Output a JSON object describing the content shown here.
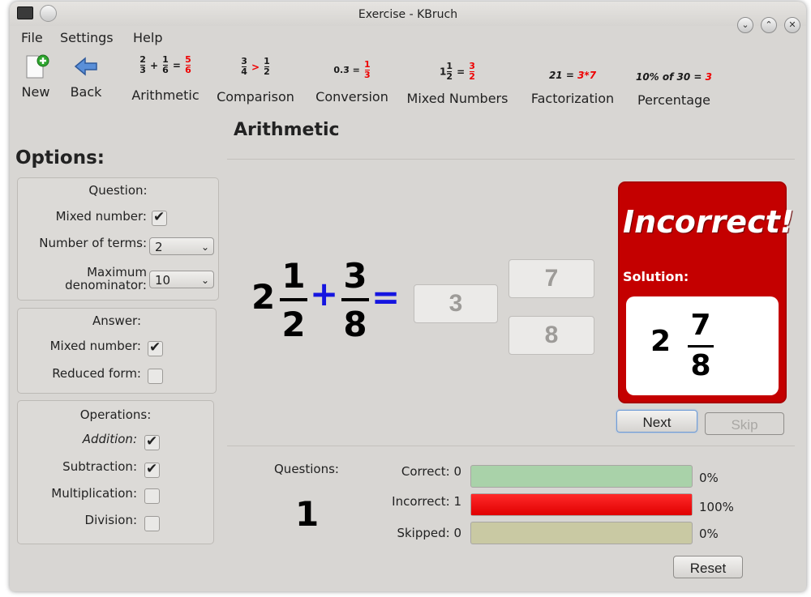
{
  "window": {
    "title": "Exercise - KBruch"
  },
  "menu": {
    "file": "File",
    "settings": "Settings",
    "help": "Help"
  },
  "toolbar": {
    "new": "New",
    "back": "Back",
    "arithmetic": "Arithmetic",
    "comparison": "Comparison",
    "conversion": "Conversion",
    "mixed_numbers": "Mixed Numbers",
    "factorization": "Factorization",
    "percentage": "Percentage",
    "icons": {
      "arithmetic": {
        "a_num": "2",
        "a_den": "3",
        "op": "+",
        "b_num": "1",
        "b_den": "6",
        "eq": "=",
        "r_num": "5",
        "r_den": "6"
      },
      "comparison": {
        "a_num": "3",
        "a_den": "4",
        "op": ">",
        "b_num": "1",
        "b_den": "2"
      },
      "conversion": {
        "left": "0.3̄ =",
        "r_num": "1",
        "r_den": "3"
      },
      "mixed": {
        "whole": "1",
        "a_num": "1",
        "a_den": "2",
        "eq": "=",
        "r_num": "3",
        "r_den": "2"
      },
      "factorization": {
        "left": "21 =",
        "right": "3*7"
      },
      "percentage": {
        "left": "10% of 30 =",
        "right": "3"
      }
    }
  },
  "heading": "Arithmetic",
  "options": {
    "title": "Options:",
    "question": {
      "title": "Question:",
      "mixed_number": "Mixed number:",
      "mixed_number_checked": true,
      "number_of_terms": "Number of terms:",
      "number_of_terms_value": "2",
      "maximum": "Maximum",
      "denominator": "denominator:",
      "max_denominator_value": "10"
    },
    "answer": {
      "title": "Answer:",
      "mixed_number": "Mixed number:",
      "mixed_number_checked": true,
      "reduced_form": "Reduced form:",
      "reduced_form_checked": false
    },
    "operations": {
      "title": "Operations:",
      "addition": "Addition:",
      "addition_checked": true,
      "subtraction": "Subtraction:",
      "subtraction_checked": true,
      "multiplication": "Multiplication:",
      "multiplication_checked": false,
      "division": "Division:",
      "division_checked": false
    }
  },
  "task": {
    "whole": "2",
    "a_num": "1",
    "a_den": "2",
    "op": "+",
    "b_num": "3",
    "b_den": "8",
    "eq": "="
  },
  "answer_inputs": {
    "whole": "3",
    "numerator": "7",
    "denominator": "8"
  },
  "result": {
    "status": "Incorrect!",
    "solution_label": "Solution:",
    "solution_whole": "2",
    "solution_num": "7",
    "solution_den": "8",
    "color": "#c40000"
  },
  "buttons": {
    "next": "Next",
    "skip": "Skip",
    "reset": "Reset"
  },
  "stats": {
    "questions_label": "Questions:",
    "questions_count": "1",
    "correct_label": "Correct: 0",
    "incorrect_label": "Incorrect: 1",
    "skipped_label": "Skipped: 0",
    "correct_pct": "0%",
    "incorrect_pct": "100%",
    "skipped_pct": "0%",
    "correct_fraction": 0,
    "incorrect_fraction": 1,
    "skipped_fraction": 0,
    "colors": {
      "correct": "#a9d2a9",
      "incorrect": "#ff2a2a",
      "skipped": "#c9c9a3"
    }
  }
}
